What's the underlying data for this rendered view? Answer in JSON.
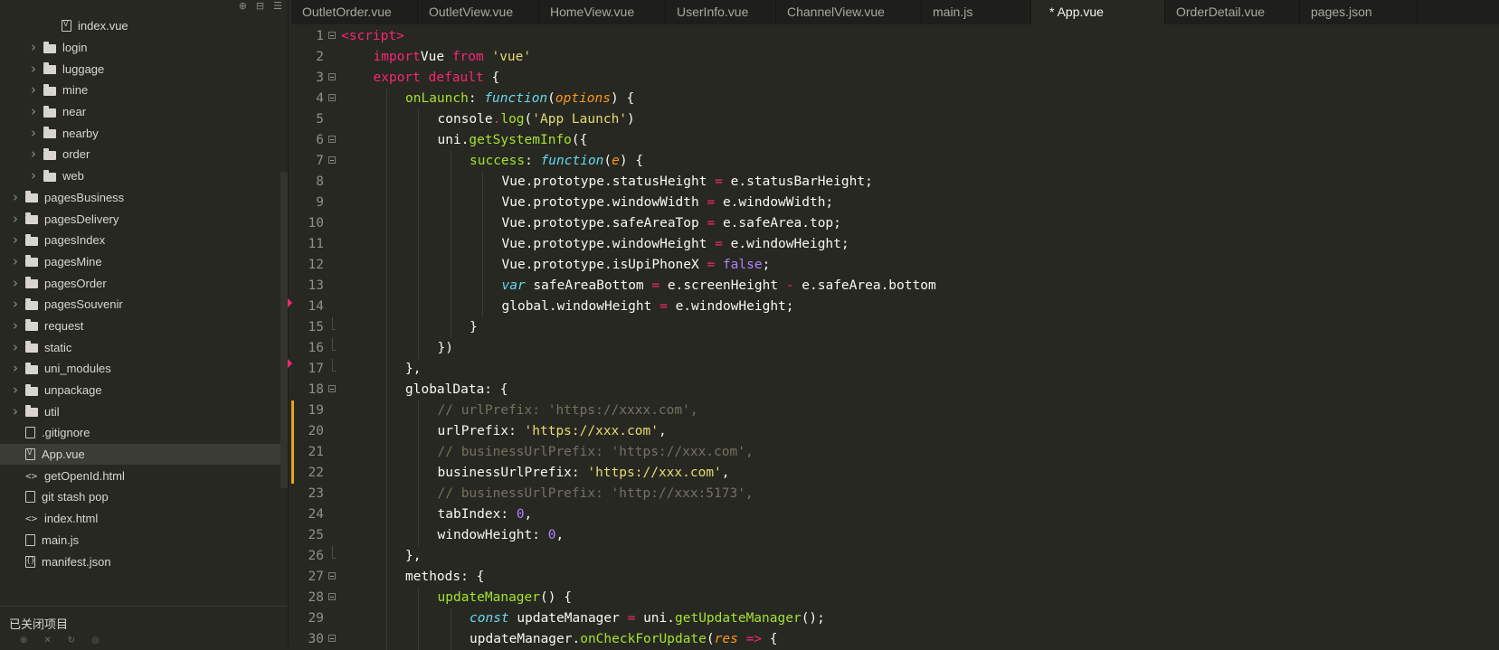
{
  "sidebar": {
    "toolbar_icons": [
      "target-icon",
      "collapse-all-icon",
      "menu-icon"
    ],
    "items": [
      {
        "label": "index.vue",
        "type": "file-vue",
        "indent": 2,
        "expandable": false
      },
      {
        "label": "login",
        "type": "folder",
        "indent": 1,
        "expandable": true
      },
      {
        "label": "luggage",
        "type": "folder",
        "indent": 1,
        "expandable": true
      },
      {
        "label": "mine",
        "type": "folder",
        "indent": 1,
        "expandable": true
      },
      {
        "label": "near",
        "type": "folder",
        "indent": 1,
        "expandable": true
      },
      {
        "label": "nearby",
        "type": "folder",
        "indent": 1,
        "expandable": true
      },
      {
        "label": "order",
        "type": "folder",
        "indent": 1,
        "expandable": true
      },
      {
        "label": "web",
        "type": "folder",
        "indent": 1,
        "expandable": true
      },
      {
        "label": "pagesBusiness",
        "type": "folder",
        "indent": 0,
        "expandable": true
      },
      {
        "label": "pagesDelivery",
        "type": "folder",
        "indent": 0,
        "expandable": true
      },
      {
        "label": "pagesIndex",
        "type": "folder",
        "indent": 0,
        "expandable": true
      },
      {
        "label": "pagesMine",
        "type": "folder",
        "indent": 0,
        "expandable": true
      },
      {
        "label": "pagesOrder",
        "type": "folder",
        "indent": 0,
        "expandable": true
      },
      {
        "label": "pagesSouvenir",
        "type": "folder",
        "indent": 0,
        "expandable": true
      },
      {
        "label": "request",
        "type": "folder",
        "indent": 0,
        "expandable": true
      },
      {
        "label": "static",
        "type": "folder",
        "indent": 0,
        "expandable": true
      },
      {
        "label": "uni_modules",
        "type": "folder",
        "indent": 0,
        "expandable": true
      },
      {
        "label": "unpackage",
        "type": "folder",
        "indent": 0,
        "expandable": true
      },
      {
        "label": "util",
        "type": "folder",
        "indent": 0,
        "expandable": true
      },
      {
        "label": ".gitignore",
        "type": "file",
        "indent": 0,
        "expandable": false
      },
      {
        "label": "App.vue",
        "type": "file-vue",
        "indent": 0,
        "expandable": false,
        "active": true
      },
      {
        "label": "getOpenId.html",
        "type": "html",
        "indent": 0,
        "expandable": false
      },
      {
        "label": "git stash pop",
        "type": "file",
        "indent": 0,
        "expandable": false
      },
      {
        "label": "index.html",
        "type": "html",
        "indent": 0,
        "expandable": false
      },
      {
        "label": "main.js",
        "type": "file",
        "indent": 0,
        "expandable": false
      },
      {
        "label": "manifest.json",
        "type": "file-json",
        "indent": 0,
        "expandable": false
      }
    ],
    "footer": {
      "title": "已关闭项目",
      "icons": [
        "add-icon",
        "delete-icon",
        "refresh-icon",
        "globe-icon"
      ]
    }
  },
  "tabs": [
    {
      "label": "OutletOrder.vue",
      "active": false
    },
    {
      "label": "OutletView.vue",
      "active": false
    },
    {
      "label": "HomeView.vue",
      "active": false
    },
    {
      "label": "UserInfo.vue",
      "active": false
    },
    {
      "label": "ChannelView.vue",
      "active": false
    },
    {
      "label": "main.js",
      "active": false
    },
    {
      "label": "* App.vue",
      "active": true
    },
    {
      "label": "OrderDetail.vue",
      "active": false
    },
    {
      "label": "pages.json",
      "active": false
    }
  ],
  "editor": {
    "lines": [
      {
        "n": "1",
        "fold": "open",
        "guides": 0,
        "tokens": [
          [
            "o",
            "<"
          ],
          [
            "k",
            "script"
          ],
          [
            "o",
            ">"
          ]
        ]
      },
      {
        "n": "2",
        "fold": "",
        "guides": 1,
        "tokens": [
          [
            "k",
            "import"
          ],
          [
            "",
            "Vue "
          ],
          [
            "k",
            "from"
          ],
          [
            "",
            " "
          ],
          [
            "s",
            "'vue'"
          ]
        ]
      },
      {
        "n": "3",
        "fold": "open",
        "guides": 1,
        "tokens": [
          [
            "k",
            "export"
          ],
          [
            "",
            " "
          ],
          [
            "k",
            "default"
          ],
          [
            "",
            " {"
          ]
        ]
      },
      {
        "n": "4",
        "fold": "open",
        "guides": 2,
        "tokens": [
          [
            "f",
            "onLaunch"
          ],
          [
            "",
            ": "
          ],
          [
            "st",
            "function"
          ],
          [
            "",
            "("
          ],
          [
            "p",
            "options"
          ],
          [
            "",
            ") {"
          ]
        ]
      },
      {
        "n": "5",
        "fold": "",
        "guides": 3,
        "tokens": [
          [
            "",
            "console"
          ],
          [
            "o",
            "."
          ],
          [
            "f",
            "log"
          ],
          [
            "",
            "("
          ],
          [
            "s",
            "'App Launch'"
          ],
          [
            "",
            ")"
          ]
        ]
      },
      {
        "n": "6",
        "fold": "open",
        "guides": 3,
        "tokens": [
          [
            "",
            "uni."
          ],
          [
            "f",
            "getSystemInfo"
          ],
          [
            "",
            "({"
          ]
        ]
      },
      {
        "n": "7",
        "fold": "open",
        "guides": 4,
        "tokens": [
          [
            "f",
            "success"
          ],
          [
            "",
            ": "
          ],
          [
            "st",
            "function"
          ],
          [
            "",
            "("
          ],
          [
            "p",
            "e"
          ],
          [
            "",
            ") {"
          ]
        ]
      },
      {
        "n": "8",
        "fold": "",
        "guides": 5,
        "tokens": [
          [
            "",
            "Vue.prototype.statusHeight "
          ],
          [
            "o",
            "="
          ],
          [
            "",
            " e.statusBarHeight;"
          ]
        ]
      },
      {
        "n": "9",
        "fold": "",
        "guides": 5,
        "tokens": [
          [
            "",
            "Vue.prototype.windowWidth "
          ],
          [
            "o",
            "="
          ],
          [
            "",
            " e.windowWidth;"
          ]
        ]
      },
      {
        "n": "10",
        "fold": "",
        "guides": 5,
        "tokens": [
          [
            "",
            "Vue.prototype.safeAreaTop "
          ],
          [
            "o",
            "="
          ],
          [
            "",
            " e.safeArea.top;"
          ]
        ]
      },
      {
        "n": "11",
        "fold": "",
        "guides": 5,
        "tokens": [
          [
            "",
            "Vue.prototype.windowHeight "
          ],
          [
            "o",
            "="
          ],
          [
            "",
            " e.windowHeight;"
          ]
        ]
      },
      {
        "n": "12",
        "fold": "",
        "guides": 5,
        "tokens": [
          [
            "",
            "Vue.prototype.isUpiPhoneX "
          ],
          [
            "o",
            "="
          ],
          [
            "",
            " "
          ],
          [
            "n",
            "false"
          ],
          [
            "",
            ";"
          ]
        ]
      },
      {
        "n": "13",
        "fold": "",
        "guides": 5,
        "tokens": [
          [
            "st",
            "var"
          ],
          [
            "",
            " safeAreaBottom "
          ],
          [
            "o",
            "="
          ],
          [
            "",
            " e.screenHeight "
          ],
          [
            "o",
            "-"
          ],
          [
            "",
            " e.safeArea.bottom"
          ]
        ]
      },
      {
        "n": "14",
        "fold": "",
        "guides": 5,
        "tokens": [
          [
            "",
            "global.windowHeight "
          ],
          [
            "o",
            "="
          ],
          [
            "",
            " e.windowHeight;"
          ]
        ]
      },
      {
        "n": "15",
        "fold": "end",
        "guides": 4,
        "tokens": [
          [
            "",
            "}"
          ]
        ]
      },
      {
        "n": "16",
        "fold": "end",
        "guides": 3,
        "tokens": [
          [
            "",
            "})"
          ]
        ]
      },
      {
        "n": "17",
        "fold": "end",
        "guides": 2,
        "tokens": [
          [
            "",
            "},"
          ]
        ]
      },
      {
        "n": "18",
        "fold": "open",
        "guides": 2,
        "tokens": [
          [
            "",
            "globalData: {"
          ]
        ]
      },
      {
        "n": "19",
        "fold": "",
        "guides": 3,
        "changed": true,
        "tokens": [
          [
            "c",
            "// urlPrefix: 'https://xxxx.com',"
          ]
        ]
      },
      {
        "n": "20",
        "fold": "",
        "guides": 3,
        "changed": true,
        "tokens": [
          [
            "",
            "urlPrefix: "
          ],
          [
            "s",
            "'https://xxx.com'"
          ],
          [
            "",
            ","
          ]
        ]
      },
      {
        "n": "21",
        "fold": "",
        "guides": 3,
        "changed": true,
        "tokens": [
          [
            "c",
            "// businessUrlPrefix: 'https://xxx.com',"
          ]
        ]
      },
      {
        "n": "22",
        "fold": "",
        "guides": 3,
        "changed": true,
        "tokens": [
          [
            "",
            "businessUrlPrefix: "
          ],
          [
            "s",
            "'https://xxx.com'"
          ],
          [
            "",
            ","
          ]
        ]
      },
      {
        "n": "23",
        "fold": "",
        "guides": 3,
        "tokens": [
          [
            "c",
            "// businessUrlPrefix: 'http://xxx:5173',"
          ]
        ]
      },
      {
        "n": "24",
        "fold": "",
        "guides": 3,
        "tokens": [
          [
            "",
            "tabIndex: "
          ],
          [
            "n",
            "0"
          ],
          [
            "",
            ","
          ]
        ]
      },
      {
        "n": "25",
        "fold": "",
        "guides": 3,
        "tokens": [
          [
            "",
            "windowHeight: "
          ],
          [
            "n",
            "0"
          ],
          [
            "",
            ","
          ]
        ]
      },
      {
        "n": "26",
        "fold": "end",
        "guides": 2,
        "tokens": [
          [
            "",
            "},"
          ]
        ]
      },
      {
        "n": "27",
        "fold": "open",
        "guides": 2,
        "tokens": [
          [
            "",
            "methods: {"
          ]
        ]
      },
      {
        "n": "28",
        "fold": "open",
        "guides": 3,
        "tokens": [
          [
            "f",
            "updateManager"
          ],
          [
            "",
            "() {"
          ]
        ]
      },
      {
        "n": "29",
        "fold": "",
        "guides": 4,
        "tokens": [
          [
            "st",
            "const"
          ],
          [
            "",
            " updateManager "
          ],
          [
            "o",
            "="
          ],
          [
            "",
            " uni."
          ],
          [
            "f",
            "getUpdateManager"
          ],
          [
            "",
            "();"
          ]
        ]
      },
      {
        "n": "30",
        "fold": "open",
        "guides": 4,
        "tokens": [
          [
            "",
            "updateManager."
          ],
          [
            "f",
            "onCheckForUpdate"
          ],
          [
            "",
            "("
          ],
          [
            "p",
            "res"
          ],
          [
            "",
            " "
          ],
          [
            "o",
            "=>"
          ],
          [
            "",
            " {"
          ]
        ]
      }
    ]
  }
}
